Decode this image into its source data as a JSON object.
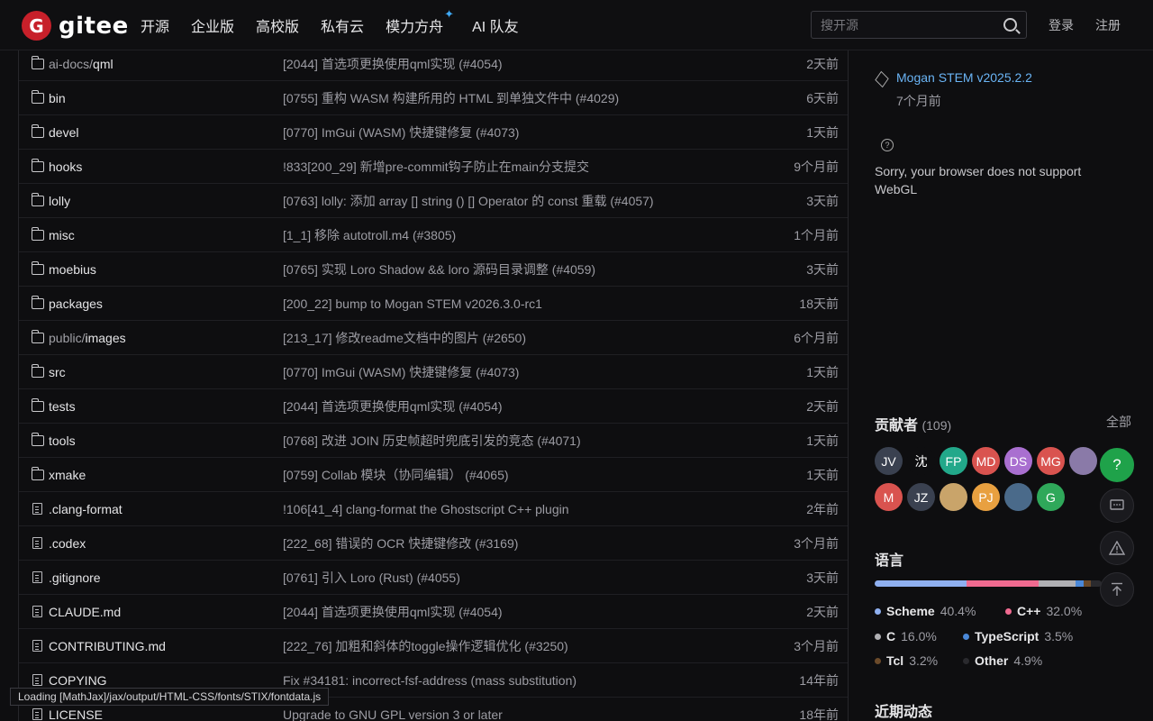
{
  "header": {
    "logo_letter": "G",
    "logo_text": "gitee",
    "nav": [
      "开源",
      "企业版",
      "高校版",
      "私有云",
      "模力方舟",
      "AI 队友"
    ],
    "spark": "✦",
    "search_placeholder": "搜开源",
    "login": "登录",
    "register": "注册"
  },
  "files": [
    {
      "type": "folder",
      "dim": "ai-docs/",
      "name": "qml",
      "message": "[2044] 首选项更换使用qml实现 (#4054)",
      "time": "2天前"
    },
    {
      "type": "folder",
      "dim": "",
      "name": "bin",
      "message": "[0755] 重构 WASM 构建所用的 HTML 到单独文件中 (#4029)",
      "time": "6天前"
    },
    {
      "type": "folder",
      "dim": "",
      "name": "devel",
      "message": "[0770] ImGui (WASM) 快捷键修复 (#4073)",
      "time": "1天前"
    },
    {
      "type": "folder",
      "dim": "",
      "name": "hooks",
      "message": "!833[200_29] 新增pre-commit钩子防止在main分支提交",
      "time": "9个月前"
    },
    {
      "type": "folder",
      "dim": "",
      "name": "lolly",
      "message": "[0763] lolly: 添加 array [] string () [] Operator 的 const 重载 (#4057)",
      "time": "3天前"
    },
    {
      "type": "folder",
      "dim": "",
      "name": "misc",
      "message": "[1_1] 移除 autotroll.m4 (#3805)",
      "time": "1个月前"
    },
    {
      "type": "folder",
      "dim": "",
      "name": "moebius",
      "message": "[0765] 实现 Loro Shadow && loro 源码目录调整 (#4059)",
      "time": "3天前"
    },
    {
      "type": "folder",
      "dim": "",
      "name": "packages",
      "message": "[200_22] bump to Mogan STEM v2026.3.0-rc1",
      "time": "18天前"
    },
    {
      "type": "folder",
      "dim": "public/",
      "name": "images",
      "message": "[213_17] 修改readme文档中的图片 (#2650)",
      "time": "6个月前"
    },
    {
      "type": "folder",
      "dim": "",
      "name": "src",
      "message": "[0770] ImGui (WASM) 快捷键修复 (#4073)",
      "time": "1天前"
    },
    {
      "type": "folder",
      "dim": "",
      "name": "tests",
      "message": "[2044] 首选项更换使用qml实现 (#4054)",
      "time": "2天前"
    },
    {
      "type": "folder",
      "dim": "",
      "name": "tools",
      "message": "[0768] 改进 JOIN 历史帧超时兜底引发的竞态 (#4071)",
      "time": "1天前"
    },
    {
      "type": "folder",
      "dim": "",
      "name": "xmake",
      "message": "[0759] Collab 模块（协同编辑） (#4065)",
      "time": "1天前"
    },
    {
      "type": "file",
      "dim": "",
      "name": ".clang-format",
      "message": "!106[41_4] clang-format the Ghostscript C++ plugin",
      "time": "2年前"
    },
    {
      "type": "file",
      "dim": "",
      "name": ".codex",
      "message": "[222_68] 错误的 OCR 快捷键修改 (#3169)",
      "time": "3个月前"
    },
    {
      "type": "file",
      "dim": "",
      "name": ".gitignore",
      "message": "[0761] 引入 Loro (Rust) (#4055)",
      "time": "3天前"
    },
    {
      "type": "file",
      "dim": "",
      "name": "CLAUDE.md",
      "message": "[2044] 首选项更换使用qml实现 (#4054)",
      "time": "2天前"
    },
    {
      "type": "file",
      "dim": "",
      "name": "CONTRIBUTING.md",
      "message": "[222_76] 加粗和斜体的toggle操作逻辑优化 (#3250)",
      "time": "3个月前"
    },
    {
      "type": "file",
      "dim": "",
      "name": "COPYING",
      "message": "Fix #34181: incorrect-fsf-address (mass substitution)",
      "time": "14年前"
    },
    {
      "type": "file",
      "dim": "",
      "name": "LICENSE",
      "message": "Upgrade to GNU GPL version 3 or later",
      "time": "18年前"
    }
  ],
  "sidebar": {
    "release_name": "Mogan STEM v2025.2.2",
    "release_time": "7个月前",
    "help_glyph": "?",
    "webgl_message": "Sorry, your browser does not support WebGL",
    "contributors_title": "贡献者",
    "contributors_count": "(109)",
    "all_label": "全部",
    "contributors": [
      {
        "text": "JV",
        "color": "#3a4150"
      },
      {
        "text": "沈",
        "color": "#0e0e10"
      },
      {
        "text": "FP",
        "color": "#22a88a"
      },
      {
        "text": "MD",
        "color": "#d9534f"
      },
      {
        "text": "DS",
        "color": "#a96fd0"
      },
      {
        "text": "MG",
        "color": "#d9534f"
      },
      {
        "text": "",
        "color": "#8a7aa8"
      },
      {
        "text": "M",
        "color": "#d9534f"
      },
      {
        "text": "JZ",
        "color": "#3a4150"
      },
      {
        "text": "",
        "color": "#c9a46a"
      },
      {
        "text": "PJ",
        "color": "#e8a040"
      },
      {
        "text": "",
        "color": "#4a6a8a"
      },
      {
        "text": "G",
        "color": "#2fa85a"
      }
    ],
    "language_title": "语言",
    "languages": [
      {
        "name": "Scheme",
        "percent": "40.4%",
        "value": 40.4,
        "color": "#8fb0f0"
      },
      {
        "name": "C++",
        "percent": "32.0%",
        "value": 32.0,
        "color": "#f06a90"
      },
      {
        "name": "C",
        "percent": "16.0%",
        "value": 16.0,
        "color": "#b0b0b4"
      },
      {
        "name": "TypeScript",
        "percent": "3.5%",
        "value": 3.5,
        "color": "#4a88d8"
      },
      {
        "name": "Tcl",
        "percent": "3.2%",
        "value": 3.2,
        "color": "#6b4a2a"
      },
      {
        "name": "Other",
        "percent": "4.9%",
        "value": 4.9,
        "color": "#2a2a2e"
      }
    ],
    "activity_title": "近期动态"
  },
  "fab": {
    "help": "?"
  },
  "status_text": "Loading [MathJax]/jax/output/HTML-CSS/fonts/STIX/fontdata.js"
}
